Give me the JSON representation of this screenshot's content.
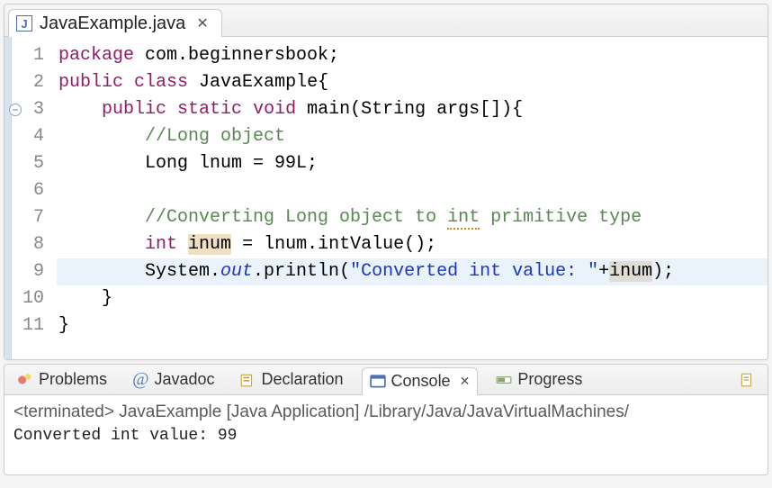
{
  "editor": {
    "tab": {
      "filename": "JavaExample.java"
    },
    "lines": [
      {
        "n": 1,
        "tokens": [
          [
            "kw",
            "package"
          ],
          [
            "",
            " com.beginnersbook;"
          ]
        ]
      },
      {
        "n": 2,
        "tokens": [
          [
            "kw",
            "public"
          ],
          [
            "",
            " "
          ],
          [
            "kw",
            "class"
          ],
          [
            "",
            " JavaExample{"
          ]
        ]
      },
      {
        "n": 3,
        "fold": true,
        "tokens": [
          [
            "",
            "    "
          ],
          [
            "kw",
            "public"
          ],
          [
            "",
            " "
          ],
          [
            "kw",
            "static"
          ],
          [
            "",
            " "
          ],
          [
            "kw",
            "void"
          ],
          [
            "",
            " main(String args[]){"
          ]
        ]
      },
      {
        "n": 4,
        "tokens": [
          [
            "",
            "        "
          ],
          [
            "comment",
            "//Long object"
          ]
        ]
      },
      {
        "n": 5,
        "tokens": [
          [
            "",
            "        Long lnum = 99L;"
          ]
        ]
      },
      {
        "n": 6,
        "tokens": [
          [
            "",
            ""
          ]
        ]
      },
      {
        "n": 7,
        "tokens": [
          [
            "",
            "        "
          ],
          [
            "comment",
            "//Converting Long object to "
          ],
          [
            "comment warn-underline",
            "int"
          ],
          [
            "comment",
            " primitive type"
          ]
        ]
      },
      {
        "n": 8,
        "tokens": [
          [
            "",
            "        "
          ],
          [
            "kw",
            "int"
          ],
          [
            "",
            " "
          ],
          [
            "hl-ident",
            "inum"
          ],
          [
            "",
            " = lnum.intValue();"
          ]
        ]
      },
      {
        "n": 9,
        "highlight": true,
        "tokens": [
          [
            "",
            "        System."
          ],
          [
            "static-field",
            "out"
          ],
          [
            "",
            ".println("
          ],
          [
            "str",
            "\"Converted int value: \""
          ],
          [
            "",
            "+"
          ],
          [
            "hl-ident-grey",
            "inum"
          ],
          [
            "",
            ");"
          ]
        ]
      },
      {
        "n": 10,
        "tokens": [
          [
            "",
            "    }"
          ]
        ]
      },
      {
        "n": 11,
        "tokens": [
          [
            "",
            "}"
          ]
        ]
      }
    ]
  },
  "bottom_tabs": {
    "problems": "Problems",
    "javadoc": "Javadoc",
    "declaration": "Declaration",
    "console": "Console",
    "progress": "Progress"
  },
  "console": {
    "status": "<terminated> JavaExample [Java Application] /Library/Java/JavaVirtualMachines/",
    "output": "Converted int value: 99"
  }
}
